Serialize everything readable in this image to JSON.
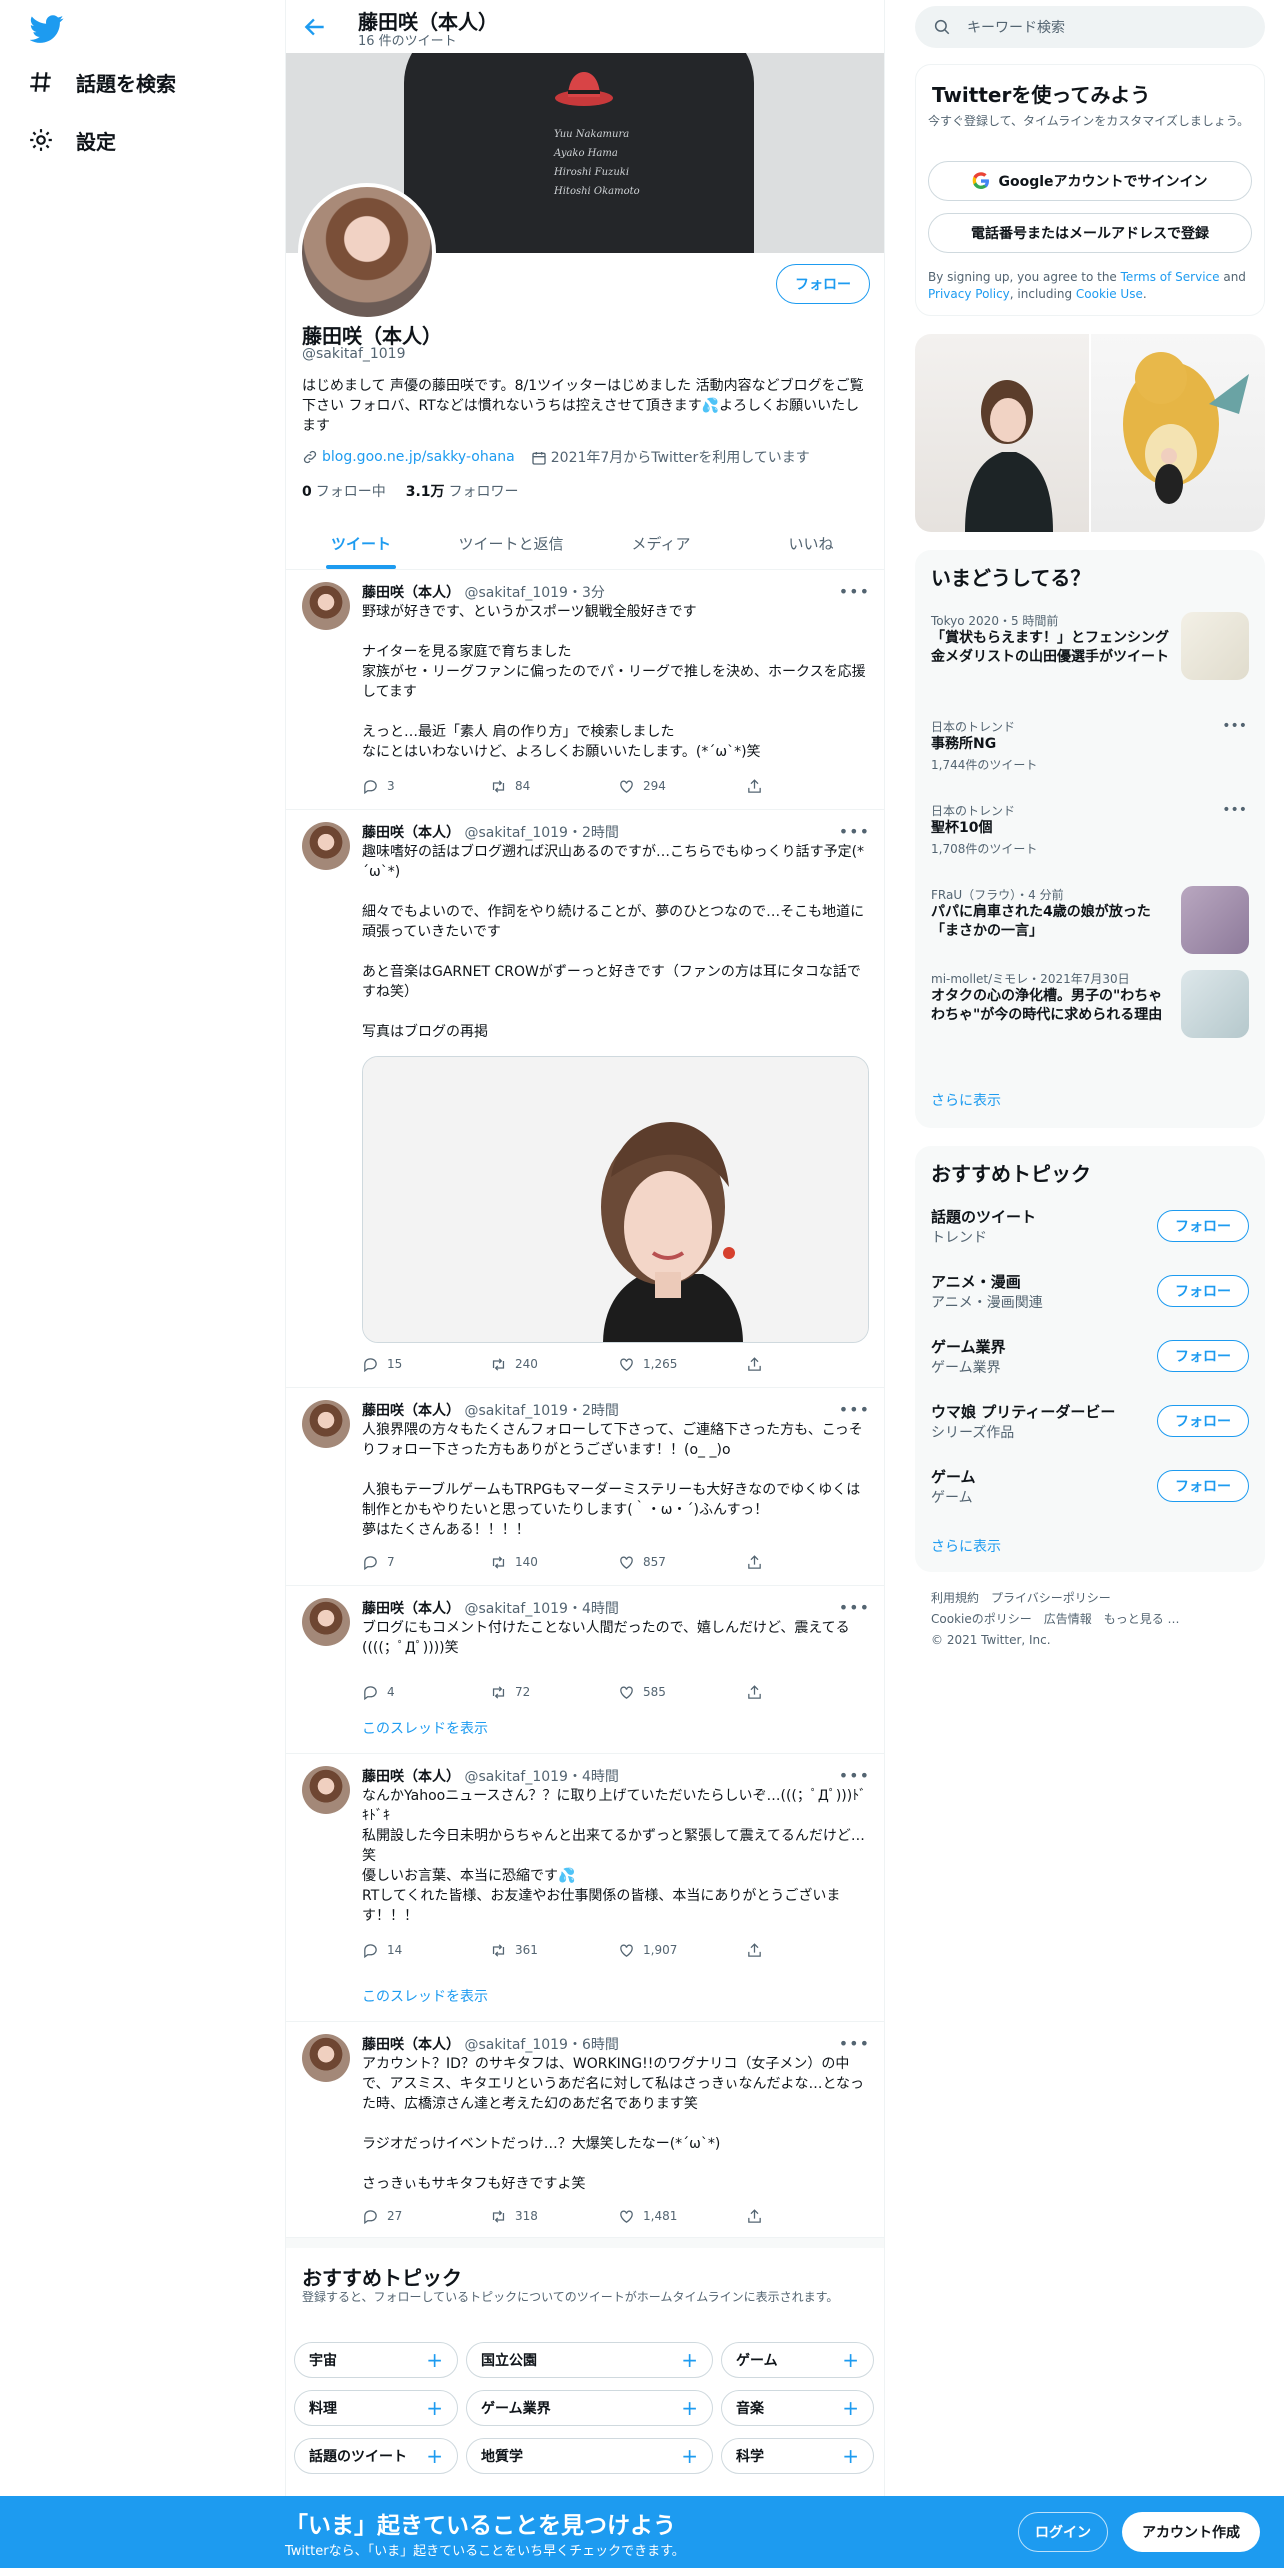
{
  "nav": {
    "explore": "話題を検索",
    "settings": "設定"
  },
  "header": {
    "name": "藤田咲（本人）",
    "tweet_count": "16 件のツイート"
  },
  "banner": {
    "lines": [
      "Yuu Nakamura",
      "Ayako Hama",
      "Hiroshi Fuzuki",
      "Hitoshi Okamoto"
    ]
  },
  "profile": {
    "name": "藤田咲（本人）",
    "handle": "@sakitaf_1019",
    "follow": "フォロー",
    "bio": "はじめまして 声優の藤田咲です。8/1ツイッターはじめました 活動内容などブログをご覧下さい フォロバ、RTなどは慣れないうちは控えさせて頂きます💦よろしくお願いいたします",
    "link": "blog.goo.ne.jp/sakky-ohana",
    "joined": "2021年7月からTwitterを利用しています",
    "following_num": "0",
    "following_label": "フォロー中",
    "followers_num": "3.1万",
    "followers_label": "フォロワー"
  },
  "tabs": [
    "ツイート",
    "ツイートと返信",
    "メディア",
    "いいね"
  ],
  "tweets": [
    {
      "name": "藤田咲（本人）",
      "meta": "@sakitaf_1019・3分",
      "text": "野球が好きです、というかスポーツ観戦全般好きです\n\nナイターを見る家庭で育ちました\n家族がセ・リーグファンに偏ったのでパ・リーグで推しを決め、ホークスを応援してます\n\nえっと…最近「素人 肩の作り方」で検索しました\nなにとはいわないけど、よろしくお願いいたします。(*´ω`*)笑",
      "replies": "3",
      "retweets": "84",
      "likes": "294"
    },
    {
      "name": "藤田咲（本人）",
      "meta": "@sakitaf_1019・2時間",
      "text": "趣味嗜好の話はブログ遡れば沢山あるのですが…こちらでもゆっくり話す予定(*´ω`*)\n\n細々でもよいので、作詞をやり続けることが、夢のひとつなので…そこも地道に頑張っていきたいです\n\nあと音楽はGARNET CROWがずーっと好きです（ファンの方は耳にタコな話ですね笑）\n\n写真はブログの再掲",
      "replies": "15",
      "retweets": "240",
      "likes": "1,265"
    },
    {
      "name": "藤田咲（本人）",
      "meta": "@sakitaf_1019・2時間",
      "text": "人狼界隈の方々もたくさんフォローして下さって、ご連絡下さった方も、こっそりフォロー下さった方もありがとうございます！！(o_ _)o\n\n人狼もテーブルゲームもTRPGもマーダーミステリーも大好きなのでゆくゆくは制作とかもやりたいと思っていたりします(｀・ω・´)ふんすっ！\n夢はたくさんある！！！！",
      "replies": "7",
      "retweets": "140",
      "likes": "857"
    },
    {
      "name": "藤田咲（本人）",
      "meta": "@sakitaf_1019・4時間",
      "text": "ブログにもコメント付けたことない人間だったので、嬉しんだけど、震えてる((((；ﾟДﾟ))))笑",
      "replies": "4",
      "retweets": "72",
      "likes": "585",
      "thread": "このスレッドを表示"
    },
    {
      "name": "藤田咲（本人）",
      "meta": "@sakitaf_1019・4時間",
      "text": "なんかYahooニュースさん？？に取り上げていただいたらしいぞ…(((；ﾟДﾟ)))ﾄﾞｷﾄﾞｷ\n私開設した今日未明からちゃんと出来てるかずっと緊張して震えてるんだけど…笑\n優しいお言葉、本当に恐縮です💦\nRTしてくれた皆様、お友達やお仕事関係の皆様、本当にありがとうございます！！！",
      "replies": "14",
      "retweets": "361",
      "likes": "1,907",
      "thread": "このスレッドを表示"
    },
    {
      "name": "藤田咲（本人）",
      "meta": "@sakitaf_1019・6時間",
      "text": "アカウント？ID？のサキタフは、WORKING!!のワグナリコ（女子メン）の中で、アスミス、キタエリというあだ名に対して私はさっきぃなんだよな…となった時、広橋涼さん達と考えた幻のあだ名であります笑\n\nラジオだっけイベントだっけ…？大爆笑したなー(*´ω`*)\n\nさっきぃもサキタフも好きですよ笑",
      "replies": "27",
      "retweets": "318",
      "likes": "1,481"
    }
  ],
  "bottom_topics": {
    "title": "おすすめトピック",
    "subtitle": "登録すると、フォローしているトピックについてのツイートがホームタイムラインに表示されます。",
    "chips": [
      "宇宙",
      "国立公園",
      "ゲーム",
      "料理",
      "ゲーム業界",
      "音楽",
      "話題のツイート",
      "地質学",
      "科学"
    ]
  },
  "search": {
    "placeholder": "キーワード検索"
  },
  "signup": {
    "title": "Twitterを使ってみよう",
    "desc": "今すぐ登録して、タイムラインをカスタマイズしましょう。",
    "google": "Googleアカウントでサインイン",
    "phone": "電話番号またはメールアドレスで登録",
    "legal_1": "By signing up, you agree to the ",
    "tos": "Terms of Service",
    "legal_2": " and ",
    "privacy": "Privacy Policy",
    "legal_3": ", including ",
    "cookie": "Cookie Use",
    "legal_4": "."
  },
  "trends": {
    "title": "いまどうしてる？",
    "items": [
      {
        "meta": "Tokyo 2020・5 時間前",
        "title": "「賞状もらえます！」とフェンシング金メダリストの山田優選手がツイート"
      },
      {
        "meta": "日本のトレンド",
        "title": "事務所NG",
        "count": "1,744件のツイート"
      },
      {
        "meta": "日本のトレンド",
        "title": "聖杯10個",
        "count": "1,708件のツイート"
      },
      {
        "meta": "FRaU（フラウ）・4 分前",
        "title": "パパに肩車された4歳の娘が放った「まさかの一言」"
      },
      {
        "meta": "mi-mollet/ミモレ・2021年7月30日",
        "title": "オタクの心の浄化槽。男子の\"わちゃわちゃ\"が今の時代に求められる理由"
      }
    ],
    "show_more": "さらに表示"
  },
  "topics": {
    "title": "おすすめトピック",
    "items": [
      {
        "name": "話題のツイート",
        "category": "トレンド"
      },
      {
        "name": "アニメ・漫画",
        "category": "アニメ・漫画関連"
      },
      {
        "name": "ゲーム業界",
        "category": "ゲーム業界"
      },
      {
        "name": "ウマ娘 プリティーダービー",
        "category": "シリーズ作品"
      },
      {
        "name": "ゲーム",
        "category": "ゲーム"
      }
    ],
    "follow": "フォロー",
    "show_more": "さらに表示"
  },
  "footer": {
    "line1": "利用規約　プライバシーポリシー",
    "line2": "Cookieのポリシー　広告情報　もっと見る …",
    "line3": "© 2021 Twitter, Inc."
  },
  "bottom_bar": {
    "title": "「いま」起きていることを見つけよう",
    "subtitle": "Twitterなら、「いま」起きていることをいち早くチェックできます。",
    "login": "ログイン",
    "signup": "アカウント作成"
  },
  "colors": {
    "accent": "#1d9bf0",
    "text": "#0f1419",
    "secondary": "#536471"
  }
}
